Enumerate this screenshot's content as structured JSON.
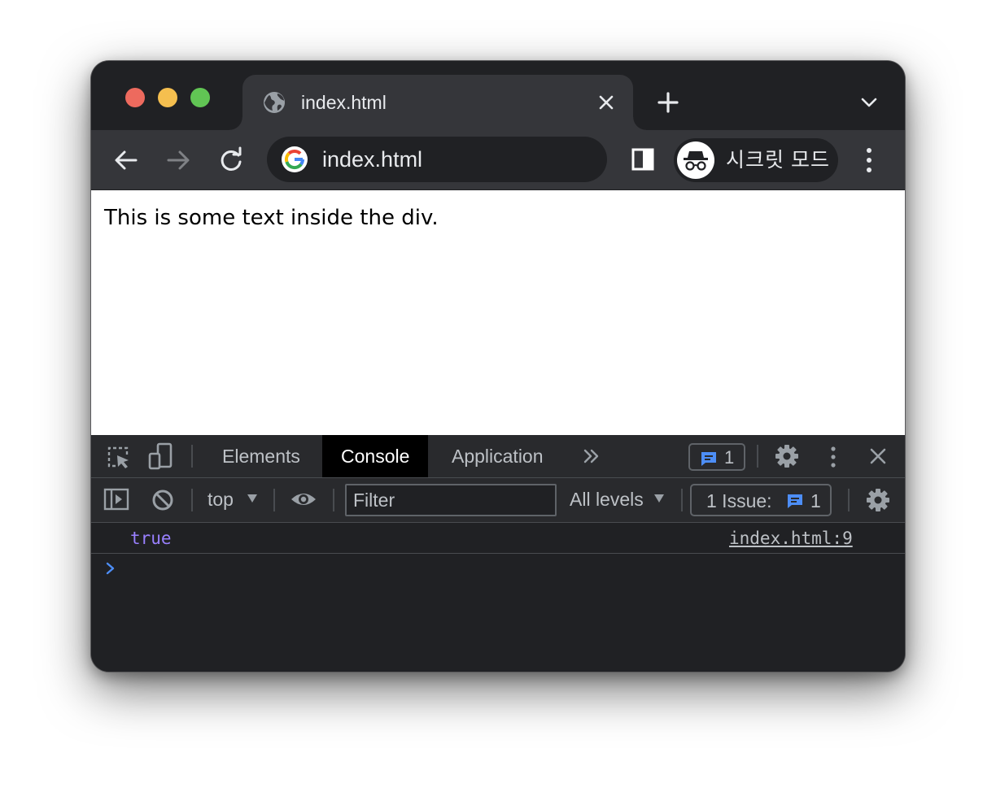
{
  "browser": {
    "tab": {
      "title": "index.html",
      "favicon": "globe-icon"
    },
    "address_bar": {
      "url": "index.html",
      "icon": "google-logo"
    },
    "incognito": {
      "label": "시크릿 모드",
      "icon": "incognito-icon"
    }
  },
  "page": {
    "body_text": "This is some text inside the div."
  },
  "devtools": {
    "tabs": [
      {
        "label": "Elements",
        "active": false
      },
      {
        "label": "Console",
        "active": true
      },
      {
        "label": "Application",
        "active": false
      }
    ],
    "issues_badge_count": "1",
    "console_toolbar": {
      "context": "top",
      "filter_placeholder": "Filter",
      "levels": "All levels",
      "issues_label": "1 Issue:",
      "issues_count": "1"
    },
    "log": [
      {
        "value": "true",
        "source": "index.html:9"
      }
    ]
  },
  "colors": {
    "frame": "#202124",
    "toolbar": "#35363a",
    "devtools_bar": "#292a2d",
    "log_value": "#9980ff",
    "accent_blue": "#4d8ef7",
    "traffic_red": "#ed6a5e",
    "traffic_yellow": "#f5bf4f",
    "traffic_green": "#61c554"
  }
}
